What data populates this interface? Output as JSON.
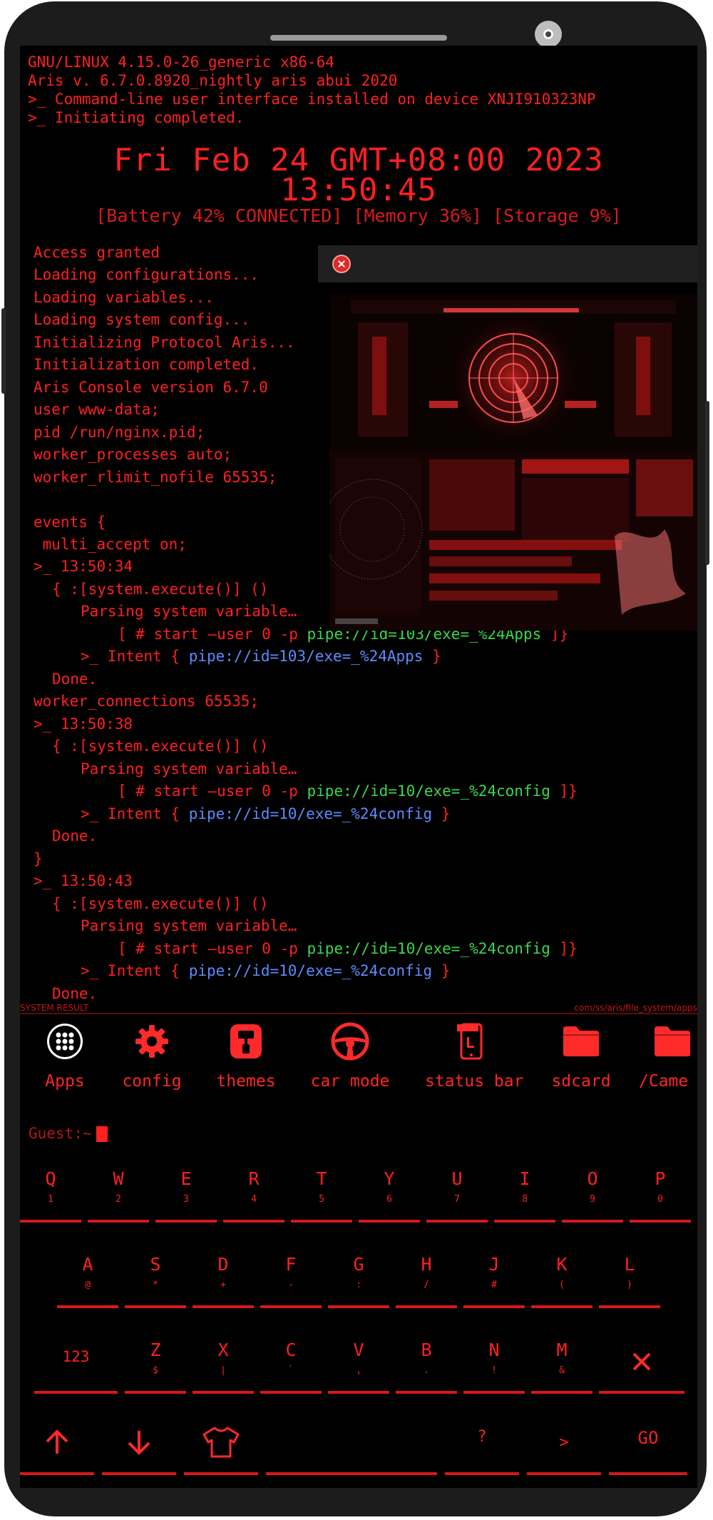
{
  "boot": {
    "line1": "GNU/LINUX 4.15.0-26_generic x86-64",
    "line2": "Aris v. 6.7.0.8920_nightly aris abui 2020",
    "line3": ">_ Command-line user interface installed on device XNJI910323NP",
    "line4": ">_ Initiating completed."
  },
  "clock": {
    "date": "Fri Feb 24 GMT+08:00 2023",
    "time": "13:50:45"
  },
  "status_line": "[Battery 42% CONNECTED] [Memory 36%] [Storage 9%]",
  "console": [
    "Access granted",
    "Loading configurations...",
    "Loading variables...",
    "Loading system config...",
    "Initializing Protocol Aris...",
    "Initialization completed.",
    "Aris Console version 6.7.0",
    "user www-data;",
    "pid /run/nginx.pid;",
    "worker_processes auto;",
    "worker_rlimit_nofile 65535;",
    "",
    "events {",
    " multi_accept on;"
  ],
  "exec_blocks": [
    {
      "prompt": ">_ 13:50:34",
      "call": "{ :[system.execute()] ()",
      "parsing": "Parsing system variable…",
      "start_prefix": "[ # start —user 0 -p ",
      "start_pipe": "pipe://id=103/exe=_%24Apps",
      "start_suffix": " ]}",
      "intent_prefix": ">_ Intent { ",
      "intent_pipe": "pipe://id=103/exe=_%24Apps",
      "intent_suffix": " }",
      "done": "Done."
    },
    {
      "prompt": ">_ 13:50:38",
      "call": "{ :[system.execute()] ()",
      "parsing": "Parsing system variable…",
      "start_prefix": "[ # start —user 0 -p ",
      "start_pipe": "pipe://id=10/exe=_%24config",
      "start_suffix": " ]}",
      "intent_prefix": ">_ Intent { ",
      "intent_pipe": "pipe://id=10/exe=_%24config",
      "intent_suffix": " }",
      "done": "Done."
    },
    {
      "prompt": ">_ 13:50:43",
      "call": "{ :[system.execute()] ()",
      "parsing": "Parsing system variable…",
      "start_prefix": "[ # start —user 0 -p ",
      "start_pipe": "pipe://id=10/exe=_%24config",
      "start_suffix": " ]}",
      "intent_prefix": ">_ Intent { ",
      "intent_pipe": "pipe://id=10/exe=_%24config",
      "intent_suffix": " }",
      "done": "Done."
    }
  ],
  "worker_connections": "worker_connections 65535;",
  "closing_brace": "}",
  "result_bar": {
    "left": "SYSTEM RESULT",
    "right": "com/ss/aris/file_system/apps"
  },
  "apps": [
    {
      "label": "Apps",
      "icon": "apps-grid-icon"
    },
    {
      "label": "config",
      "icon": "gear-icon"
    },
    {
      "label": "themes",
      "icon": "paint-roller-icon"
    },
    {
      "label": "car mode",
      "icon": "steering-wheel-icon"
    },
    {
      "label": "status bar",
      "icon": "phone-status-icon"
    },
    {
      "label": "sdcard",
      "icon": "folder-icon"
    },
    {
      "label": "/Came",
      "icon": "folder-icon"
    }
  ],
  "prompt": "Guest:~",
  "keyboard": {
    "row1": [
      {
        "k": "Q",
        "s": "1"
      },
      {
        "k": "W",
        "s": "2"
      },
      {
        "k": "E",
        "s": "3"
      },
      {
        "k": "R",
        "s": "4"
      },
      {
        "k": "T",
        "s": "5"
      },
      {
        "k": "Y",
        "s": "6"
      },
      {
        "k": "U",
        "s": "7"
      },
      {
        "k": "I",
        "s": "8"
      },
      {
        "k": "O",
        "s": "9"
      },
      {
        "k": "P",
        "s": "0"
      }
    ],
    "row2": [
      {
        "k": "A",
        "s": "@"
      },
      {
        "k": "S",
        "s": "*"
      },
      {
        "k": "D",
        "s": "+"
      },
      {
        "k": "F",
        "s": "-"
      },
      {
        "k": "G",
        "s": ":"
      },
      {
        "k": "H",
        "s": "/"
      },
      {
        "k": "J",
        "s": "#"
      },
      {
        "k": "K",
        "s": "("
      },
      {
        "k": "L",
        "s": ")"
      }
    ],
    "row3": [
      {
        "k": "Z",
        "s": "$"
      },
      {
        "k": "X",
        "s": "|"
      },
      {
        "k": "C",
        "s": "`"
      },
      {
        "k": "V",
        "s": ","
      },
      {
        "k": "B",
        "s": "."
      },
      {
        "k": "N",
        "s": "!"
      },
      {
        "k": "M",
        "s": "&"
      }
    ],
    "numbers_key": "123",
    "question_key": "?",
    "gt_key": ">",
    "go_key": "GO"
  },
  "colors": {
    "accent": "#ff2020",
    "link_blue": "#5b8cff",
    "link_green": "#39d84a",
    "background": "#000000"
  }
}
